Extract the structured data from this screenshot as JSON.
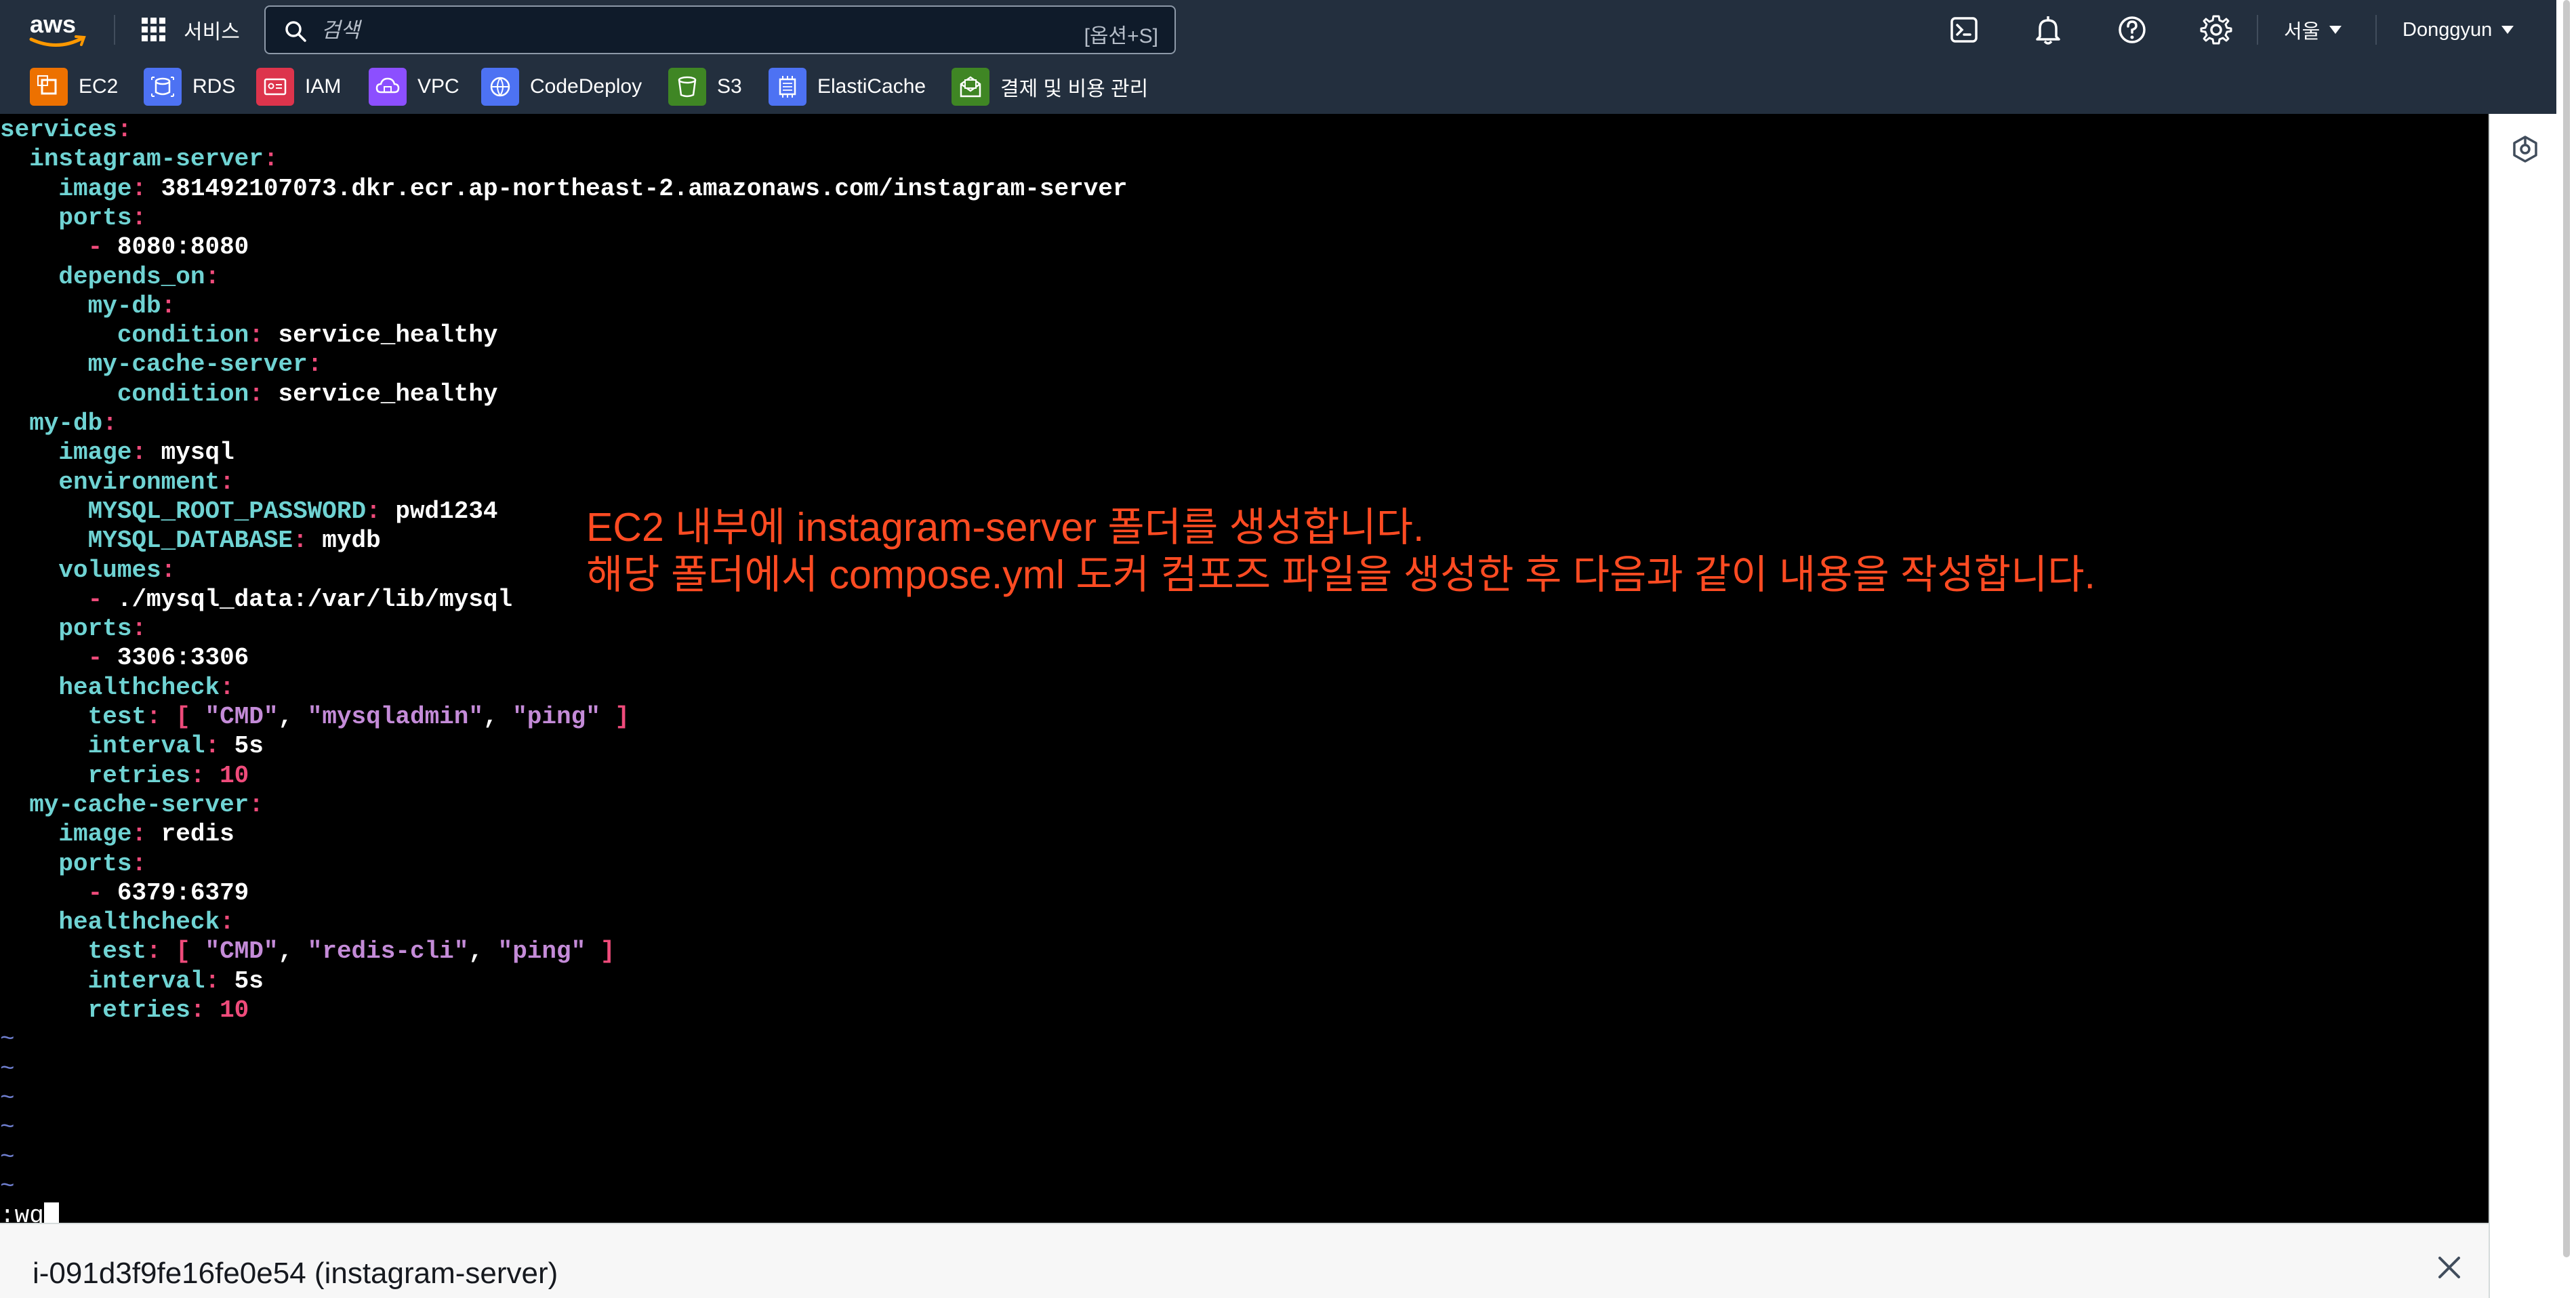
{
  "header": {
    "services_label": "서비스",
    "search_placeholder": "검색",
    "search_shortcut": "[옵션+S]",
    "region": "서울",
    "user": "Donggyun"
  },
  "favorites": [
    {
      "label": "EC2",
      "color": "#ed7100"
    },
    {
      "label": "RDS",
      "color": "#4d72f3"
    },
    {
      "label": "IAM",
      "color": "#dd344c"
    },
    {
      "label": "VPC",
      "color": "#8c4fff"
    },
    {
      "label": "CodeDeploy",
      "color": "#4d72f3"
    },
    {
      "label": "S3",
      "color": "#3f8624"
    },
    {
      "label": "ElastiCache",
      "color": "#4d72f3"
    },
    {
      "label": "결제 및 비용 관리",
      "color": "#3f8624"
    }
  ],
  "terminal": {
    "lines": [
      {
        "indent": "",
        "key": "services",
        "sep": ":",
        "value": ""
      },
      {
        "indent": "  ",
        "key": "instagram-server",
        "sep": ":",
        "value": ""
      },
      {
        "indent": "    ",
        "key": "image",
        "sep": ": ",
        "value": "381492107073.dkr.ecr.ap-northeast-2.amazonaws.com/instagram-server"
      },
      {
        "indent": "    ",
        "key": "ports",
        "sep": ":",
        "value": ""
      },
      {
        "indent": "      ",
        "dash": "- ",
        "value": "8080:8080"
      },
      {
        "indent": "    ",
        "key": "depends_on",
        "sep": ":",
        "value": ""
      },
      {
        "indent": "      ",
        "key": "my-db",
        "sep": ":",
        "value": ""
      },
      {
        "indent": "        ",
        "key": "condition",
        "sep": ": ",
        "value": "service_healthy"
      },
      {
        "indent": "      ",
        "key": "my-cache-server",
        "sep": ":",
        "value": ""
      },
      {
        "indent": "        ",
        "key": "condition",
        "sep": ": ",
        "value": "service_healthy"
      },
      {
        "indent": "  ",
        "key": "my-db",
        "sep": ":",
        "value": ""
      },
      {
        "indent": "    ",
        "key": "image",
        "sep": ": ",
        "value": "mysql"
      },
      {
        "indent": "    ",
        "key": "environment",
        "sep": ":",
        "value": ""
      },
      {
        "indent": "      ",
        "key": "MYSQL_ROOT_PASSWORD",
        "sep": ": ",
        "value": "pwd1234"
      },
      {
        "indent": "      ",
        "key": "MYSQL_DATABASE",
        "sep": ": ",
        "value": "mydb"
      },
      {
        "indent": "    ",
        "key": "volumes",
        "sep": ":",
        "value": ""
      },
      {
        "indent": "      ",
        "dash": "- ",
        "value": "./mysql_data:/var/lib/mysql"
      },
      {
        "indent": "    ",
        "key": "ports",
        "sep": ":",
        "value": ""
      },
      {
        "indent": "      ",
        "dash": "- ",
        "value": "3306:3306"
      },
      {
        "indent": "    ",
        "key": "healthcheck",
        "sep": ":",
        "value": ""
      },
      {
        "indent": "      ",
        "key": "test",
        "sep": ": ",
        "list": [
          "\"CMD\"",
          "\"mysqladmin\"",
          "\"ping\""
        ]
      },
      {
        "indent": "      ",
        "key": "interval",
        "sep": ": ",
        "value": "5s"
      },
      {
        "indent": "      ",
        "key": "retries",
        "sep": ": ",
        "num": "10"
      },
      {
        "indent": "  ",
        "key": "my-cache-server",
        "sep": ":",
        "value": ""
      },
      {
        "indent": "    ",
        "key": "image",
        "sep": ": ",
        "value": "redis"
      },
      {
        "indent": "    ",
        "key": "ports",
        "sep": ":",
        "value": ""
      },
      {
        "indent": "      ",
        "dash": "- ",
        "value": "6379:6379"
      },
      {
        "indent": "    ",
        "key": "healthcheck",
        "sep": ":",
        "value": ""
      },
      {
        "indent": "      ",
        "key": "test",
        "sep": ": ",
        "list": [
          "\"CMD\"",
          "\"redis-cli\"",
          "\"ping\""
        ]
      },
      {
        "indent": "      ",
        "key": "interval",
        "sep": ": ",
        "value": "5s"
      },
      {
        "indent": "      ",
        "key": "retries",
        "sep": ": ",
        "num": "10"
      },
      {
        "tilde": "~"
      },
      {
        "tilde": "~"
      },
      {
        "tilde": "~"
      },
      {
        "tilde": "~"
      },
      {
        "tilde": "~"
      },
      {
        "tilde": "~"
      }
    ],
    "command": ":wq"
  },
  "annotation": {
    "line1": "EC2 내부에 instagram-server 폴더를 생성합니다.",
    "line2": "해당 폴더에서 compose.yml 도커 컴포즈 파일을 생성한 후 다음과 같이 내용을 작성합니다."
  },
  "session": {
    "instance_label": "i-091d3f9fe16fe0e54 (instagram-server)"
  }
}
